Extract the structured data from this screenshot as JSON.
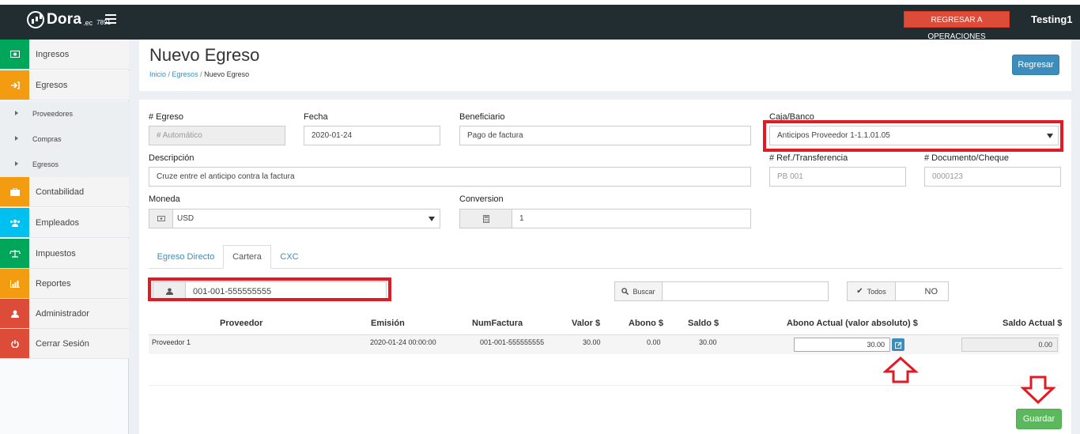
{
  "topbar": {
    "brand": "Dora",
    "brand_suffix": ".ec",
    "version": "7891",
    "back_to_ops": "REGRESAR A OPERACIONES",
    "user": "Testing1"
  },
  "sidebar": {
    "items": [
      {
        "label": "Ingresos",
        "icon": "money-icon",
        "color": "#00a65a"
      },
      {
        "label": "Egresos",
        "icon": "sign-out-icon",
        "color": "#f39c12"
      },
      {
        "label": "Contabilidad",
        "icon": "briefcase-icon",
        "color": "#f39c12"
      },
      {
        "label": "Empleados",
        "icon": "users-icon",
        "color": "#00c0ef"
      },
      {
        "label": "Impuestos",
        "icon": "balance-scale-icon",
        "color": "#00a65a"
      },
      {
        "label": "Reportes",
        "icon": "bar-chart-icon",
        "color": "#f39c12"
      },
      {
        "label": "Administrador",
        "icon": "user-icon",
        "color": "#dd4b39"
      },
      {
        "label": "Cerrar Sesión",
        "icon": "power-icon",
        "color": "#dd4b39"
      }
    ],
    "egresos_submenu": [
      "Proveedores",
      "Compras",
      "Egresos"
    ]
  },
  "header": {
    "title": "Nuevo Egreso",
    "breadcrumb": [
      "Inicio",
      "Egresos",
      "Nuevo Egreso"
    ],
    "back_button": "Regresar"
  },
  "form": {
    "egreso_label": "# Egreso",
    "egreso_placeholder": "# Automático",
    "fecha_label": "Fecha",
    "fecha_value": "2020-01-24",
    "beneficiario_label": "Beneficiario",
    "beneficiario_value": "Pago de factura",
    "caja_label": "Caja/Banco",
    "caja_value": "Anticipos Proveedor 1-1.1.01.05",
    "descripcion_label": "Descripción",
    "descripcion_value": "Cruze entre el anticipo contra la factura",
    "ref_label": "# Ref./Transferencia",
    "ref_placeholder": "PB 001",
    "doc_label": "# Documento/Cheque",
    "doc_placeholder": "0000123",
    "moneda_label": "Moneda",
    "moneda_value": "USD",
    "conversion_label": "Conversion",
    "conversion_value": "1"
  },
  "tabs": [
    "Egreso Directo",
    "Cartera",
    "CXC"
  ],
  "active_tab": "Cartera",
  "cartera": {
    "provider_doc": "001-001-555555555",
    "search_label": "Buscar",
    "todos_label": "Todos",
    "toggle_value": "NO",
    "columns": [
      "Proveedor",
      "Emisión",
      "NumFactura",
      "Valor $",
      "Abono $",
      "Saldo $",
      "Abono Actual (valor absoluto) $",
      "Saldo Actual $"
    ],
    "rows": [
      {
        "proveedor": "Proveedor 1",
        "emision": "2020-01-24 00:00:00",
        "num_factura": "001-001-555555555",
        "valor": "30.00",
        "abono": "0.00",
        "saldo": "30.00",
        "abono_actual": "30.00",
        "saldo_actual": "0.00"
      }
    ]
  },
  "footer": {
    "save_button": "Guardar"
  },
  "colors": {
    "topbar": "#222d32",
    "accent_blue": "#3c8dbc",
    "highlight_red": "#e21a23",
    "save_green": "#5cb85c",
    "danger": "#dd4b39"
  }
}
